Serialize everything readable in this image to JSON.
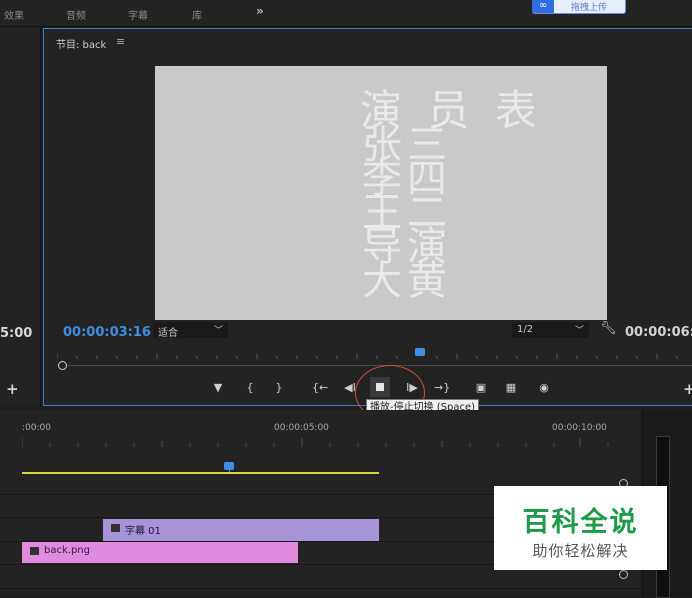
{
  "workspace_tabs": [
    "效果",
    "音频",
    "字幕",
    "库"
  ],
  "more_glyph": "»",
  "upload_button": "拖拽上传",
  "left_panel": {
    "timecode": "5:00",
    "add": "+"
  },
  "program_monitor": {
    "title": "节目: back",
    "menu_glyph": "≡",
    "video_text": {
      "heading": "演 员 表",
      "col_left": [
        "张",
        "李",
        "王",
        "导",
        "大"
      ],
      "col_right": [
        "三",
        "四",
        "二",
        "演",
        "黄"
      ]
    },
    "timecode_current": "00:00:03:16",
    "zoom_value": "适合",
    "resolution_value": "1/2",
    "timecode_duration": "00:00:06:1",
    "tooltip": "播放-停止切换 (Space)",
    "add": "+"
  },
  "transport_icons": [
    "add-marker-icon",
    "mark-in-icon",
    "mark-out-icon",
    "go-to-in-icon",
    "step-back-icon",
    "play-stop-icon",
    "step-forward-icon",
    "go-to-out-icon",
    "lift-icon",
    "extract-icon",
    "export-frame-icon"
  ],
  "timeline": {
    "ruler_labels": [
      ":00:00",
      "00:00:05:00",
      "00:00:10:00"
    ],
    "clips": [
      {
        "name": "字幕 01",
        "track": "V2",
        "color": "#a693d8"
      },
      {
        "name": "back.png",
        "track": "V1",
        "color": "#e08be0"
      }
    ]
  },
  "watermark": {
    "title": "百科全说",
    "subtitle": "助你轻松解决"
  },
  "colors": {
    "accent": "#3d8fe6",
    "workarea": "#d9d43a",
    "highlight": "#d84c3c"
  }
}
